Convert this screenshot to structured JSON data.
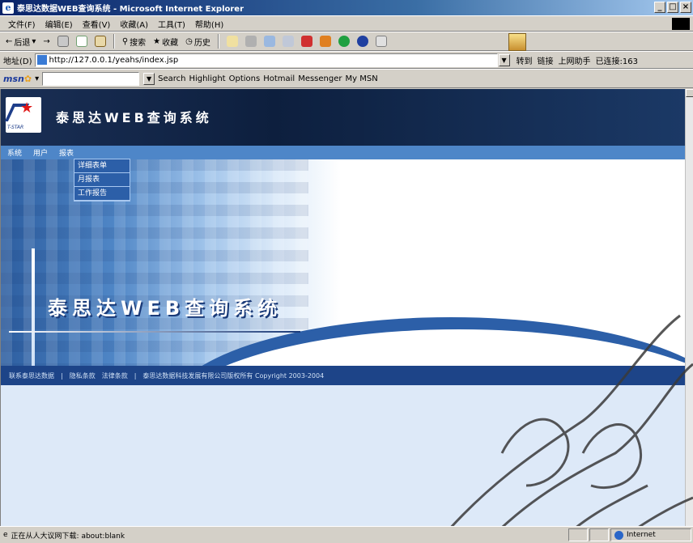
{
  "window": {
    "title": "泰思达数据WEB查询系统 - Microsoft Internet Explorer",
    "controls": [
      "_",
      "□",
      "×"
    ]
  },
  "menubar": {
    "items": [
      "文件(F)",
      "编辑(E)",
      "查看(V)",
      "收藏(A)",
      "工具(T)",
      "帮助(H)"
    ]
  },
  "toolbar": {
    "back": "后退",
    "search": "搜索",
    "favorites": "收藏",
    "history": "历史"
  },
  "addressbar": {
    "label": "地址(D)",
    "url": "http://127.0.0.1/yeahs/index.jsp",
    "go": "转到",
    "links": "链接",
    "online": "上网助手",
    "connected": "已连接:163"
  },
  "msnbar": {
    "brand": "msn",
    "search": "Search",
    "highlight": "Highlight",
    "options": "Options",
    "hotmail": "Hotmail",
    "messenger": "Messenger",
    "my_msn": "My MSN"
  },
  "app": {
    "banner_title": "泰思达WEB查询系统",
    "logo_text": "T-STAR",
    "nav": [
      "系统",
      "用户",
      "报表"
    ],
    "dropdown": [
      "详细表单",
      "月报表",
      "工作报告"
    ],
    "hero_title": "泰思达WEB查询系统",
    "footer_links": [
      "联系泰思达数据",
      "隐私条款",
      "法律条款"
    ],
    "footer_copyright": "泰思达数据科技发展有限公司版权所有 Copyright 2003-2004"
  },
  "statusbar": {
    "text": "正在从人大议网下载: about:blank",
    "zone": "Internet"
  }
}
